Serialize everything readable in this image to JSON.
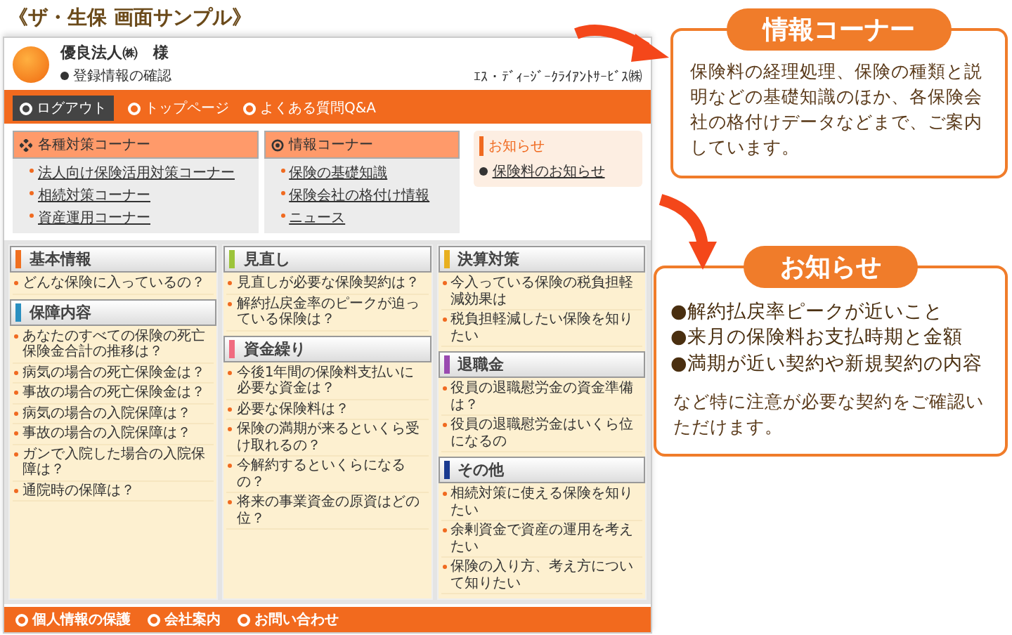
{
  "title": "《ザ・生保 画面サンプル》",
  "screen": {
    "header": {
      "customer": "優良法人㈱　様",
      "registration_link": "登録情報の確認",
      "company": "ｴｽ・ﾃﾞｨｰｼﾞｰｸﾗｲｱﾝﾄｻｰﾋﾞｽ㈱"
    },
    "nav": {
      "logout": "ログアウト",
      "links": [
        "トップページ",
        "よくある質問Q&A"
      ]
    },
    "corners": [
      {
        "title": "各種対策コーナー",
        "kind": "measures",
        "links": [
          "法人向け保険活用対策コーナー",
          "相続対策コーナー",
          "資産運用コーナー"
        ]
      },
      {
        "title": "情報コーナー",
        "kind": "info",
        "links": [
          "保険の基礎知識",
          "保険会社の格付け情報",
          "ニュース"
        ]
      }
    ],
    "notice": {
      "title": "お知らせ",
      "links": [
        "保険料のお知らせ"
      ]
    },
    "columns": [
      [
        {
          "title": "基本情報",
          "color": "#f07020",
          "items": [
            "どんな保険に入っているの？"
          ]
        },
        {
          "title": "保障内容",
          "color": "#2a8fc0",
          "items": [
            "あなたのすべての保険の死亡保険金合計の推移は？",
            "病気の場合の死亡保険金は？",
            "事故の場合の死亡保険金は？",
            "病気の場合の入院保障は？",
            "事故の場合の入院保障は？",
            "ガンで入院した場合の入院保障は？",
            "通院時の保障は？"
          ]
        }
      ],
      [
        {
          "title": "見直し",
          "color": "#9cc43a",
          "items": [
            "見直しが必要な保険契約は？",
            "解約払戻金率のピークが迫っている保険は？"
          ]
        },
        {
          "title": "資金繰り",
          "color": "#f06a80",
          "items": [
            "今後1年間の保険料支払いに必要な資金は？",
            "必要な保険料は？",
            "保険の満期が来るといくら受け取れるの？",
            "今解約するといくらになるの？",
            "将来の事業資金の原資はどの位？"
          ]
        }
      ],
      [
        {
          "title": "決算対策",
          "color": "#e8b020",
          "items": [
            "今入っている保険の税負担軽減効果は",
            "税負担軽減したい保険を知りたい"
          ]
        },
        {
          "title": "退職金",
          "color": "#9a4ab0",
          "items": [
            "役員の退職慰労金の資金準備は？",
            "役員の退職慰労金はいくら位になるの"
          ]
        },
        {
          "title": "その他",
          "color": "#1a3a90",
          "items": [
            "相続対策に使える保険を知りたい",
            "余剰資金で資産の運用を考えたい",
            "保険の入り方、考え方について知りたい"
          ]
        }
      ]
    ],
    "footer": [
      "個人情報の保護",
      "会社案内",
      "お問い合わせ"
    ]
  },
  "callouts": [
    {
      "title": "情報コーナー",
      "body": "保険料の経理処理、保険の種類と説明などの基礎知識のほか、各保険会社の格付けデータなどまで、ご案内しています。"
    },
    {
      "title": "お知らせ",
      "bullets": [
        "●解約払戻率ピークが近いこと",
        "●来月の保険料お支払時期と金額",
        "●満期が近い契約や新規契約の内容"
      ],
      "body": "など特に注意が必要な契約をご確認いただけます。"
    }
  ]
}
